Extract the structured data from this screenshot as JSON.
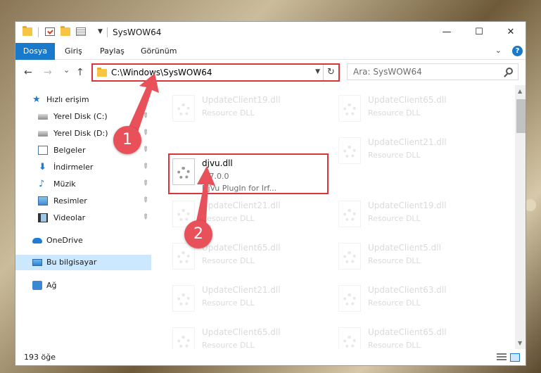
{
  "window": {
    "title": "SysWOW64",
    "minimize_glyph": "—",
    "maximize_glyph": "☐",
    "close_glyph": "✕"
  },
  "ribbon": {
    "tabs": [
      "Dosya",
      "Giriş",
      "Paylaş",
      "Görünüm"
    ],
    "help_glyph": "?"
  },
  "navbar": {
    "back_glyph": "←",
    "forward_glyph": "→",
    "recent_glyph": "⌄",
    "up_glyph": "↑",
    "address": "C:\\Windows\\SysWOW64",
    "refresh_glyph": "↻",
    "search_placeholder": "Ara: SysWOW64"
  },
  "sidebar": {
    "items": [
      {
        "label": "Hızlı erişim",
        "icon": "star-icon"
      },
      {
        "label": "Yerel Disk (C:)",
        "icon": "disk-icon",
        "pinned": true
      },
      {
        "label": "Yerel Disk (D:)",
        "icon": "disk-icon",
        "pinned": true
      },
      {
        "label": "Belgeler",
        "icon": "documents-icon",
        "pinned": true
      },
      {
        "label": "İndirmeler",
        "icon": "download-icon",
        "pinned": true
      },
      {
        "label": "Müzik",
        "icon": "music-icon",
        "pinned": true
      },
      {
        "label": "Resimler",
        "icon": "pictures-icon",
        "pinned": true
      },
      {
        "label": "Videolar",
        "icon": "videos-icon",
        "pinned": true
      },
      {
        "label": "OneDrive",
        "icon": "cloud-icon"
      },
      {
        "label": "Bu bilgisayar",
        "icon": "computer-icon",
        "selected": true
      },
      {
        "label": "Ağ",
        "icon": "network-icon"
      }
    ]
  },
  "files": {
    "ghost_tiles": [
      {
        "name": "UpdateClient19.dll",
        "type": "Resource DLL"
      },
      {
        "name": "UpdateClient65.dll",
        "type": "Resource DLL"
      },
      {
        "name": "UpdateClient21.dll",
        "type": "Resource DLL"
      },
      {
        "name": "UpdateClient21.dll",
        "type": "Resource DLL"
      },
      {
        "name": "UpdateClient19.dll",
        "type": "Resource DLL"
      },
      {
        "name": "UpdateClient65.dll",
        "type": "Resource DLL"
      },
      {
        "name": "UpdateClient5.dll",
        "type": "Resource DLL"
      },
      {
        "name": "UpdateClient21.dll",
        "type": "Resource DLL"
      },
      {
        "name": "UpdateClient63.dll",
        "type": "Resource DLL"
      },
      {
        "name": "UpdateClient65.dll",
        "type": "Resource DLL"
      },
      {
        "name": "UpdateClient65.dll",
        "type": "Resource DLL"
      }
    ],
    "active": {
      "name": "djvu.dll",
      "version": "3.7.0.0",
      "description": "DjVu PlugIn for Irf..."
    }
  },
  "status": {
    "item_count": "193 öğe"
  },
  "callouts": [
    "1",
    "2"
  ],
  "colors": {
    "accent": "#1979ca",
    "highlight_red": "#d9333b",
    "callout_red": "#e8505a",
    "selected_bg": "#cce8ff"
  }
}
